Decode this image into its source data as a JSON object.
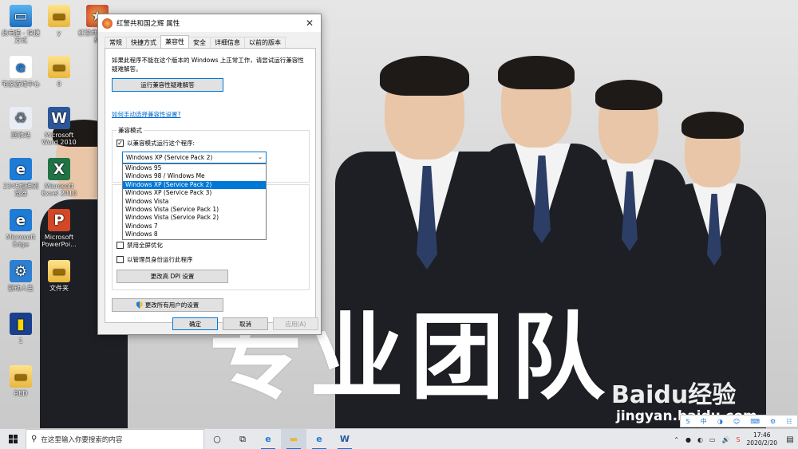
{
  "desktop": {
    "icons": [
      {
        "label": "此电脑 - 快捷方式",
        "glyph": "▭",
        "cls": "g-pc"
      },
      {
        "label": "y",
        "glyph": "▬",
        "cls": "g-folder"
      },
      {
        "label": "红警共和国之辉",
        "glyph": "★",
        "cls": "g-game"
      },
      {
        "label": "宅家游戏中心",
        "glyph": "e",
        "cls": "g-edge"
      },
      {
        "label": "0",
        "glyph": "▬",
        "cls": "g-folder"
      },
      {
        "label": "回收站",
        "glyph": "♻",
        "cls": "g-bin"
      },
      {
        "label": "Microsoft Word 2010",
        "glyph": "W",
        "cls": "g-word"
      },
      {
        "label": "2345加速浏览器",
        "glyph": "e",
        "cls": "g-edge2"
      },
      {
        "label": "Microsoft Excel 2010",
        "glyph": "X",
        "cls": "g-excel"
      },
      {
        "label": "Microsoft Edge",
        "glyph": "e",
        "cls": "g-edge2"
      },
      {
        "label": "Microsoft PowerPoi...",
        "glyph": "P",
        "cls": "g-ppt"
      },
      {
        "label": "驱动人生",
        "glyph": "⚙",
        "cls": "g-gear"
      },
      {
        "label": "文件夹",
        "glyph": "▬",
        "cls": "g-folder"
      },
      {
        "label": "1",
        "glyph": "▮",
        "cls": "g-book"
      },
      {
        "label": "RED",
        "glyph": "▬",
        "cls": "g-folder"
      }
    ],
    "slogan": "专业团队",
    "watermark": {
      "brand": "Baidu经验",
      "url": "jingyan.baidu.com"
    }
  },
  "dialog": {
    "title": "红警共和国之辉 属性",
    "close": "✕",
    "tabs": [
      "常规",
      "快捷方式",
      "兼容性",
      "安全",
      "详细信息",
      "以前的版本"
    ],
    "active_tab": "兼容性",
    "intro": "如果此程序不能在这个版本的 Windows 上正常工作，请尝试运行兼容性疑难解答。",
    "troubleshooter_button": "运行兼容性疑难解答",
    "manual_link": "如何手动选择兼容性设置?",
    "compat_mode": {
      "group_label": "兼容模式",
      "checkbox_label": "以兼容模式运行这个程序:",
      "checked": true,
      "selected": "Windows XP (Service Pack 2)",
      "options": [
        "Windows 95",
        "Windows 98 / Windows Me",
        "Windows XP (Service Pack 2)",
        "Windows XP (Service Pack 3)",
        "Windows Vista",
        "Windows Vista (Service Pack 1)",
        "Windows Vista (Service Pack 2)",
        "Windows 7",
        "Windows 8"
      ]
    },
    "settings": {
      "disable_fullscreen": "禁用全屏优化",
      "run_as_admin": "以管理员身份运行此程序",
      "dpi_button": "更改高 DPI 设置"
    },
    "all_users_button": "更改所有用户的设置",
    "ok": "确定",
    "cancel": "取消",
    "apply": "应用(A)"
  },
  "taskbar": {
    "search_placeholder": "在这里输入你要搜索的内容",
    "cortana_icon": "○",
    "taskview_icon": "⧉",
    "apps": [
      {
        "name": "edge",
        "glyph": "e"
      },
      {
        "name": "file-explorer",
        "glyph": "▬"
      },
      {
        "name": "browser",
        "glyph": "e"
      },
      {
        "name": "word",
        "glyph": "W"
      }
    ],
    "tray_icons": [
      "⌃",
      "●",
      "◐",
      "▭",
      "🔊",
      "S"
    ],
    "time": "17:46",
    "date": "2020/2/20",
    "notification": "▤"
  },
  "mini_tray": [
    "S",
    "中",
    "◑",
    "☺",
    "⌨",
    "⚙",
    "☷"
  ],
  "colors": {
    "accent": "#0078d7",
    "link": "#0066cc",
    "suit": "#1d1f24"
  }
}
